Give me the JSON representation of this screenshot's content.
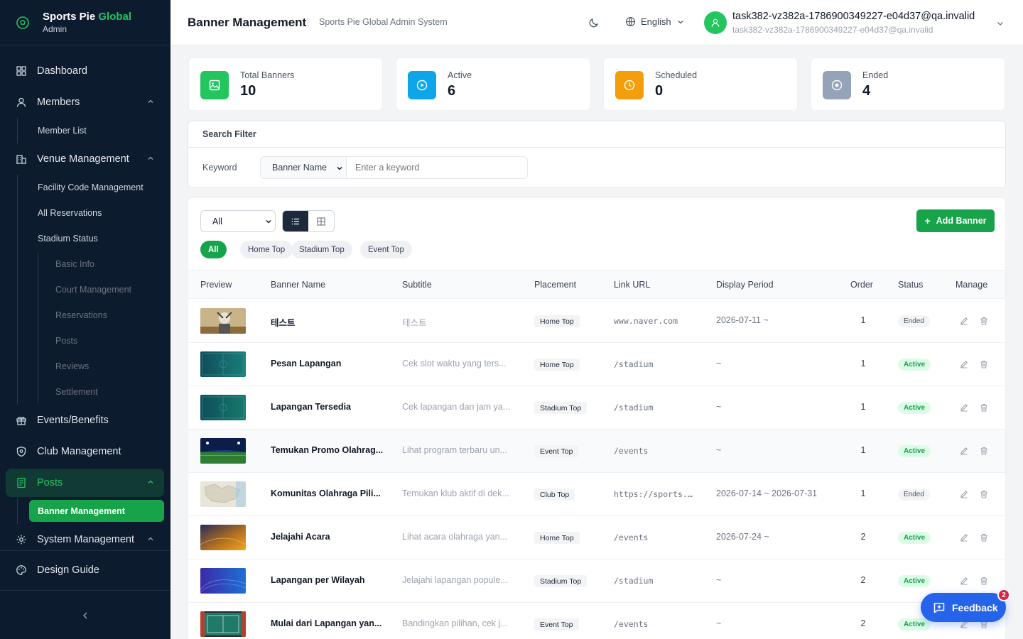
{
  "brand": {
    "name_part1": "Sports Pie ",
    "name_part2": "Global",
    "role": "Admin"
  },
  "sidebar": {
    "dashboard": "Dashboard",
    "members": "Members",
    "member_list": "Member List",
    "venue_management": "Venue Management",
    "facility_code_management": "Facility Code Management",
    "all_reservations": "All Reservations",
    "stadium_status": "Stadium Status",
    "basic_info": "Basic Info",
    "court_management": "Court Management",
    "reservations": "Reservations",
    "posts_sub": "Posts",
    "reviews": "Reviews",
    "settlement": "Settlement",
    "events_benefits": "Events/Benefits",
    "club_management": "Club Management",
    "posts": "Posts",
    "banner_management": "Banner Management",
    "system_management": "System Management",
    "design_guide": "Design Guide"
  },
  "header": {
    "title": "Banner Management",
    "subtitle": "Sports Pie Global Admin System",
    "language": "English",
    "user_name": "task382-vz382a-1786900349227-e04d37@qa.invalid",
    "user_email": "task382-vz382a-1786900349227-e04d37@qa.invalid"
  },
  "stats": [
    {
      "label": "Total Banners",
      "value": "10",
      "color": "#22c55e",
      "icon": "image-icon"
    },
    {
      "label": "Active",
      "value": "6",
      "color": "#0ea5e9",
      "icon": "play-icon"
    },
    {
      "label": "Scheduled",
      "value": "0",
      "color": "#f59e0b",
      "icon": "clock-icon"
    },
    {
      "label": "Ended",
      "value": "4",
      "color": "#94a3b8",
      "icon": "stop-icon"
    }
  ],
  "filter": {
    "title": "Search Filter",
    "keyword_label": "Keyword",
    "field_select": "Banner Name",
    "placeholder": "Enter a keyword"
  },
  "toolbar": {
    "status_select": "All",
    "add_label": "Add Banner",
    "chips": [
      "All",
      "Home Top",
      "Stadium Top",
      "Event Top"
    ]
  },
  "table": {
    "columns": [
      "Preview",
      "Banner Name",
      "Subtitle",
      "Placement",
      "Link URL",
      "Display Period",
      "Order",
      "Status",
      "Manage"
    ],
    "rows": [
      {
        "name": "테스트",
        "subtitle": "테스트",
        "placement": "Home Top",
        "url": "www.naver.com",
        "period": "2026-07-11 ~",
        "order": "1",
        "status": "Ended"
      },
      {
        "name": "Pesan Lapangan",
        "subtitle": "Cek slot waktu yang ters...",
        "placement": "Home Top",
        "url": "/stadium",
        "period": "~",
        "order": "1",
        "status": "Active"
      },
      {
        "name": "Lapangan Tersedia",
        "subtitle": "Cek lapangan dan jam ya...",
        "placement": "Stadium Top",
        "url": "/stadium",
        "period": "~",
        "order": "1",
        "status": "Active"
      },
      {
        "name": "Temukan Promo Olahrag...",
        "subtitle": "Lihat program terbaru un...",
        "placement": "Event Top",
        "url": "/events",
        "period": "~",
        "order": "1",
        "status": "Active"
      },
      {
        "name": "Komunitas Olahraga Pili...",
        "subtitle": "Temukan klub aktif di dek...",
        "placement": "Club Top",
        "url": "https://sports...",
        "period": "2026-07-14 ~ 2026-07-31",
        "order": "1",
        "status": "Ended"
      },
      {
        "name": "Jelajahi Acara",
        "subtitle": "Lihat acara olahraga yan...",
        "placement": "Home Top",
        "url": "/events",
        "period": "2026-07-24 ~",
        "order": "2",
        "status": "Active"
      },
      {
        "name": "Lapangan per Wilayah",
        "subtitle": "Jelajahi lapangan popule...",
        "placement": "Stadium Top",
        "url": "/stadium",
        "period": "~",
        "order": "2",
        "status": "Active"
      },
      {
        "name": "Mulai dari Lapangan yan...",
        "subtitle": "Bandingkan pilihan, cek j...",
        "placement": "Event Top",
        "url": "/events",
        "period": "~",
        "order": "2",
        "status": "Active"
      }
    ]
  },
  "feedback": {
    "label": "Feedback",
    "count": "2"
  }
}
